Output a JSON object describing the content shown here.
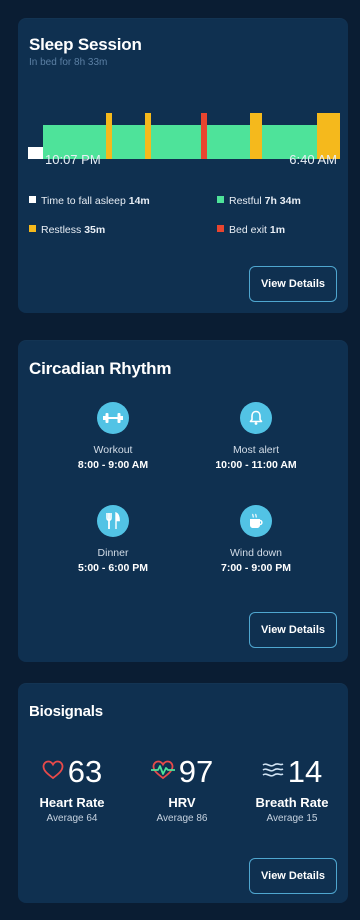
{
  "sleep": {
    "title": "Sleep Session",
    "subtitle": "In bed for 8h 33m",
    "start_time": "10:07 PM",
    "end_time": "6:40 AM",
    "legend": [
      {
        "label": "Time to fall asleep",
        "value": "14m",
        "color": "#ffffff"
      },
      {
        "label": "Restful",
        "value": "7h 34m",
        "color": "#4ee39a"
      },
      {
        "label": "Restless",
        "value": "35m",
        "color": "#f5b91c"
      },
      {
        "label": "Bed exit",
        "value": "1m",
        "color": "#e8452f"
      }
    ],
    "colors": {
      "awake": "#ffffff",
      "restful": "#4ee39a",
      "restless": "#f5b91c",
      "bed_exit": "#e8452f"
    },
    "view_details": "View Details"
  },
  "circadian": {
    "title": "Circadian Rhythm",
    "items": [
      {
        "icon": "dumbbell-icon",
        "label": "Workout",
        "time": "8:00 - 9:00 AM"
      },
      {
        "icon": "bell-icon",
        "label": "Most alert",
        "time": "10:00 - 11:00 AM"
      },
      {
        "icon": "utensils-icon",
        "label": "Dinner",
        "time": "5:00 - 6:00 PM"
      },
      {
        "icon": "mug-icon",
        "label": "Wind down",
        "time": "7:00 - 9:00 PM"
      }
    ],
    "view_details": "View Details"
  },
  "biosignals": {
    "title": "Biosignals",
    "items": [
      {
        "icon": "heart-icon",
        "value": "63",
        "name": "Heart Rate",
        "average": "Average 64"
      },
      {
        "icon": "hrv-heart-icon",
        "value": "97",
        "name": "HRV",
        "average": "Average 86"
      },
      {
        "icon": "breath-icon",
        "value": "14",
        "name": "Breath Rate",
        "average": "Average 15"
      }
    ],
    "view_details": "View Details"
  }
}
